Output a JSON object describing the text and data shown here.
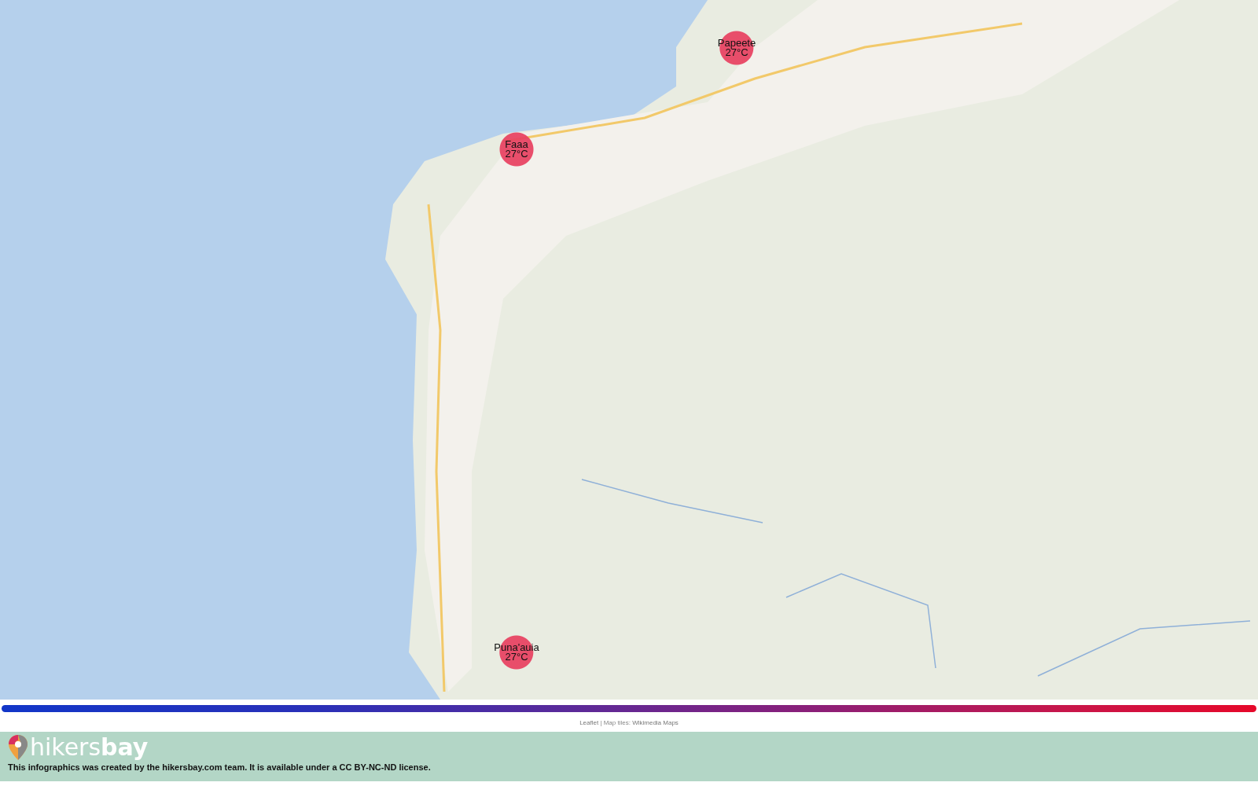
{
  "map": {
    "markers": [
      {
        "name": "Faaa",
        "temperature": "27°C"
      },
      {
        "name": "Papeete",
        "temperature": "27°C"
      },
      {
        "name": "Puna'auia",
        "temperature": "27°C"
      }
    ]
  },
  "attribution": {
    "library": "Leaflet",
    "separator": "|",
    "prefix": "Map tiles:",
    "source": "Wikimedia Maps"
  },
  "footer": {
    "logo": "hikers**bay**",
    "notice": "This infographics was created by the hikersbay.com team. It is available under a CC BY-NC-ND license."
  }
}
